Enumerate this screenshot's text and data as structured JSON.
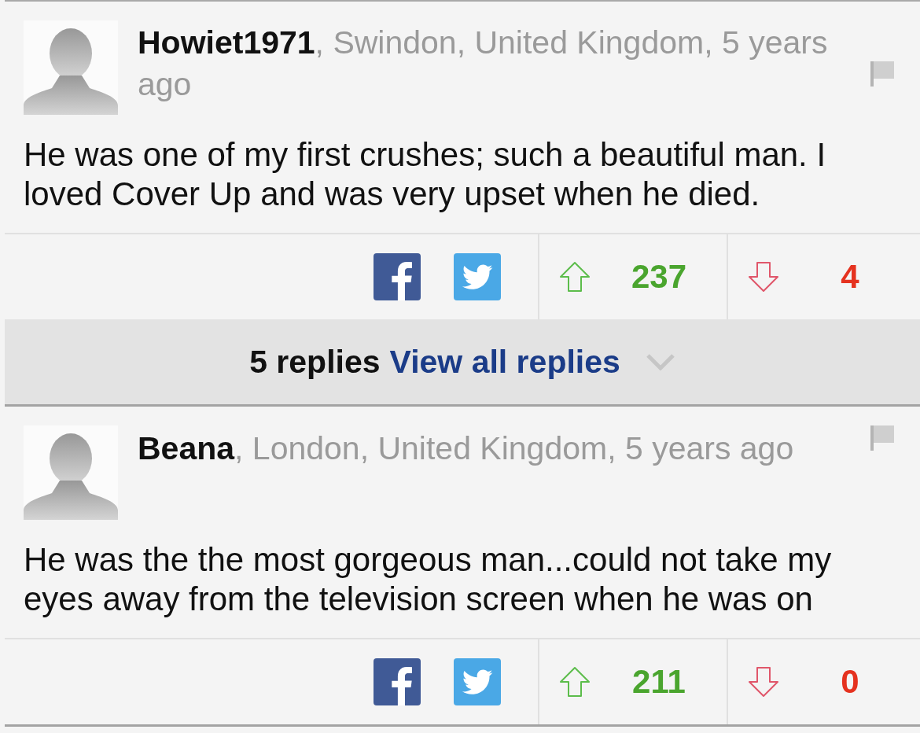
{
  "comments": [
    {
      "header": "**Howiet1971**, Swindon, United Kingdom, 5 years ago",
      "body": "He was one of my first crushes; such a beautiful man. I loved Cover Up and was very upset when he died.",
      "upvotes": "237",
      "downvotes": "4",
      "replies": {
        "count": "5 replies",
        "link": "View all replies"
      }
    },
    {
      "header": "**Beana**, London, United Kingdom, 5 years ago",
      "body": "He was the the most gorgeous man...could not take my eyes away from the television screen when he was on",
      "upvotes": "211",
      "downvotes": "0"
    }
  ]
}
